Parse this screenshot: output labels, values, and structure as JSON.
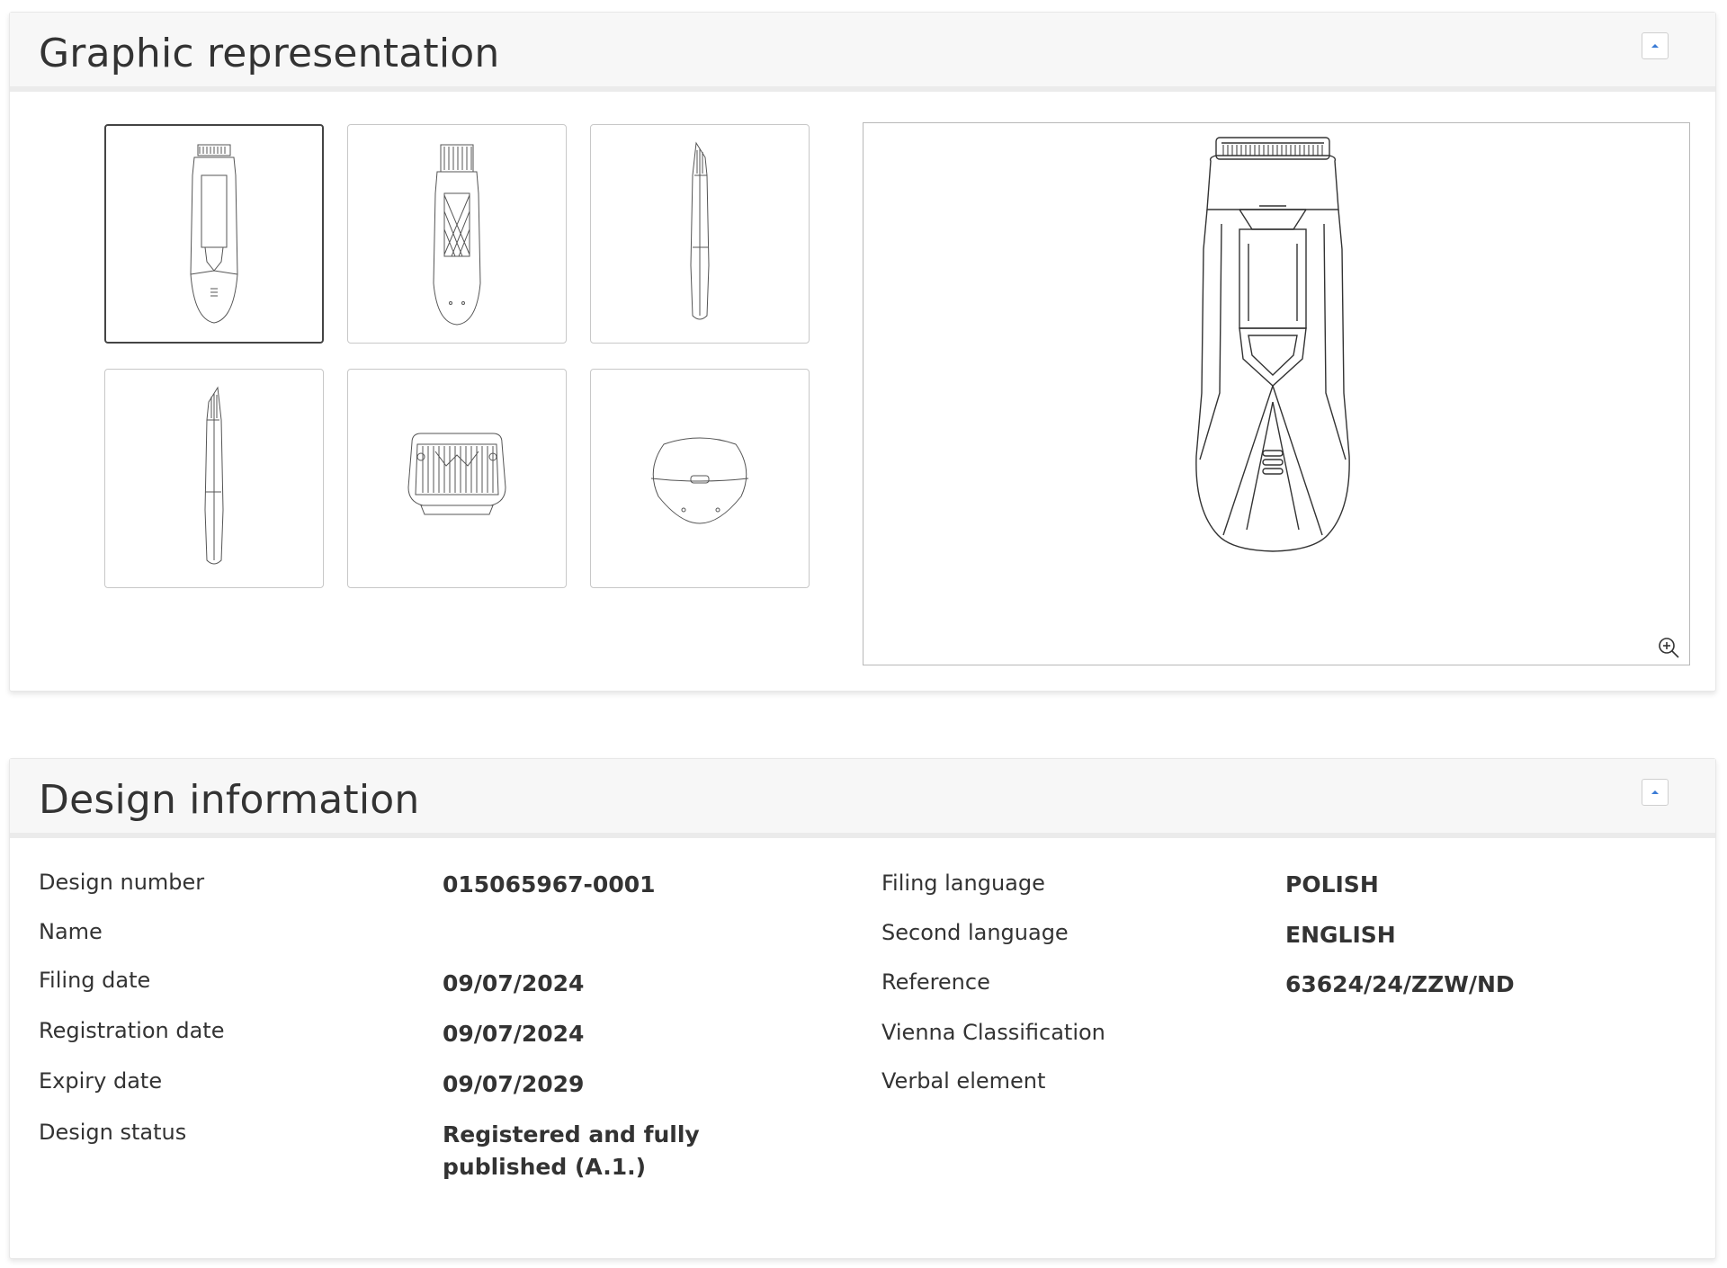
{
  "graphic": {
    "title": "Graphic representation",
    "thumbnails": [
      {
        "view": "front"
      },
      {
        "view": "back"
      },
      {
        "view": "side-left"
      },
      {
        "view": "side-right"
      },
      {
        "view": "top"
      },
      {
        "view": "bottom"
      }
    ],
    "selected_index": 0
  },
  "info": {
    "title": "Design information",
    "left": [
      {
        "label": "Design number",
        "value": "015065967-0001"
      },
      {
        "label": "Name",
        "value": ""
      },
      {
        "label": "Filing date",
        "value": "09/07/2024"
      },
      {
        "label": "Registration date",
        "value": "09/07/2024"
      },
      {
        "label": "Expiry date",
        "value": "09/07/2029"
      },
      {
        "label": "Design status",
        "value": "Registered and fully published (A.1.)"
      }
    ],
    "right": [
      {
        "label": "Filing language",
        "value": "POLISH"
      },
      {
        "label": "Second language",
        "value": "ENGLISH"
      },
      {
        "label": "Reference",
        "value": "63624/24/ZZW/ND"
      },
      {
        "label": "Vienna Classification",
        "value": ""
      },
      {
        "label": "Verbal element",
        "value": ""
      }
    ]
  },
  "icons": {
    "collapse": "chevron-up-icon",
    "zoom": "zoom-in-icon"
  },
  "colors": {
    "accent": "#3a7bd5",
    "header_bg": "#f7f7f7",
    "text": "#333333"
  }
}
